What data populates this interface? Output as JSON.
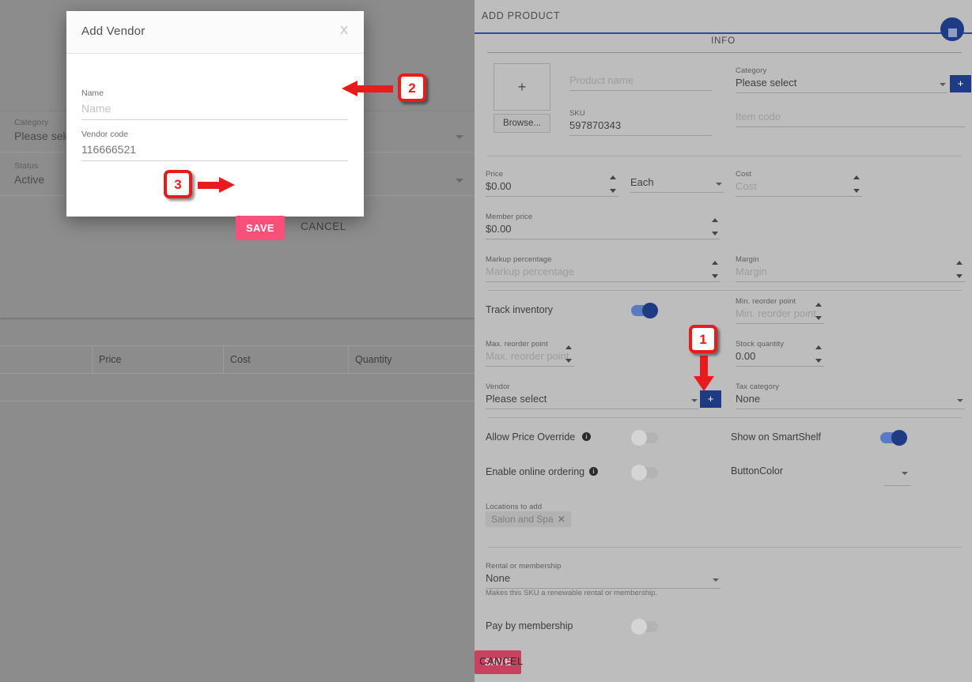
{
  "background": {
    "category": {
      "label": "Category",
      "value": "Please select"
    },
    "status": {
      "label": "Status",
      "value": "Active"
    },
    "table": {
      "columns": [
        "",
        "Price",
        "Cost",
        "Quantity"
      ]
    }
  },
  "modal": {
    "title": "Add Vendor",
    "close_label": "X",
    "name": {
      "label": "Name",
      "placeholder": "Name",
      "value": ""
    },
    "vendor_code": {
      "label": "Vendor code",
      "placeholder": "Vendor code",
      "value": "116666521"
    },
    "save_label": "SAVE",
    "cancel_label": "CANCEL"
  },
  "panel": {
    "title": "ADD PRODUCT",
    "tab": "INFO",
    "stop_button": "stop-icon",
    "image": {
      "plus": "+",
      "browse_label": "Browse..."
    },
    "product_name": {
      "label": "Product name",
      "placeholder": "Product name",
      "value": ""
    },
    "sku": {
      "label": "SKU",
      "placeholder": "SKU",
      "value": "597870343"
    },
    "category": {
      "label": "Category",
      "value": "Please select"
    },
    "category_add": "+",
    "item_code": {
      "label": "Item code",
      "placeholder": "Item code",
      "value": ""
    },
    "price": {
      "label": "Price",
      "value": "$0.00"
    },
    "unit": {
      "value": "Each"
    },
    "cost": {
      "label": "Cost",
      "placeholder": "Cost",
      "value": ""
    },
    "member_price": {
      "label": "Member price",
      "value": "$0.00"
    },
    "markup_percentage": {
      "label": "Markup percentage",
      "placeholder": "Markup percentage",
      "value": ""
    },
    "margin": {
      "label": "Margin",
      "placeholder": "Margin",
      "value": ""
    },
    "track_inventory": {
      "label": "Track inventory",
      "state": "on"
    },
    "min_reorder_point": {
      "label": "Min. reorder point",
      "placeholder": "Min. reorder point",
      "value": ""
    },
    "max_reorder_point": {
      "label": "Max. reorder point",
      "placeholder": "Max. reorder point",
      "value": ""
    },
    "stock_quantity": {
      "label": "Stock quantity",
      "value": "0.00"
    },
    "vendor": {
      "label": "Vendor",
      "value": "Please select"
    },
    "vendor_add": "+",
    "tax_category": {
      "label": "Tax category",
      "value": "None"
    },
    "allow_price_override": {
      "label": "Allow Price Override",
      "state": "off",
      "info": "i"
    },
    "show_on_smartshelf": {
      "label": "Show on SmartShelf",
      "state": "on"
    },
    "enable_online_ordering": {
      "label": "Enable online ordering",
      "state": "off",
      "info": "i"
    },
    "button_color": {
      "label": "ButtonColor",
      "value": ""
    },
    "locations": {
      "label": "Locations to add",
      "chips": [
        "Salon and Spa"
      ],
      "chip_remove": "✕"
    },
    "rental": {
      "label": "Rental or membership",
      "value": "None",
      "helper": "Makes this SKU a renewable rental or membership."
    },
    "pay_by_membership": {
      "label": "Pay by membership",
      "state": "off"
    },
    "save_label": "SAVE",
    "cancel_label": "CANCEL"
  },
  "annotations": {
    "markers": [
      {
        "number": "1",
        "direction": "down"
      },
      {
        "number": "2",
        "direction": "left"
      },
      {
        "number": "3",
        "direction": "right"
      }
    ],
    "accent_color": "#e81c1c"
  },
  "colors": {
    "panel_background": "#bdbdbd",
    "overlay": "#8c8c8c",
    "accent_blue": "#1f3b83",
    "accent_pink": "#f75179",
    "accent_pink_muted": "#c8425f"
  }
}
